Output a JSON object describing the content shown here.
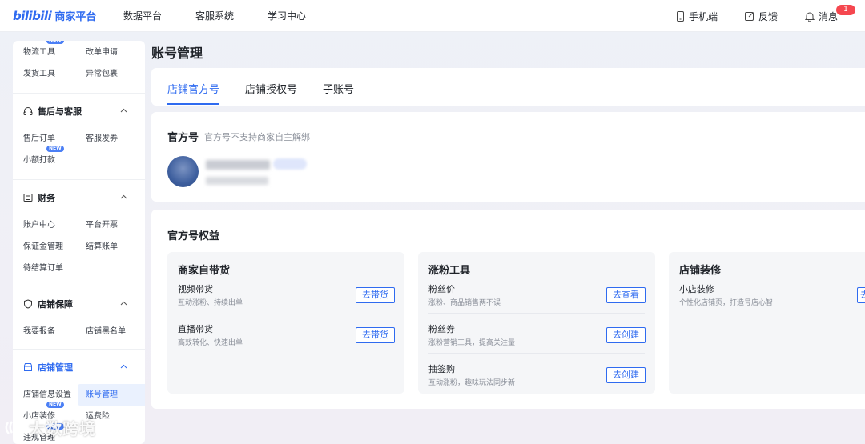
{
  "topbar": {
    "logo_mark": "bilibili",
    "logo_text": "商家平台",
    "nav": [
      "数据平台",
      "客服系统",
      "学习中心"
    ],
    "mobile": "手机端",
    "feedback": "反馈",
    "messages": "消息",
    "message_count": "1"
  },
  "sidebar": {
    "new_tag": "NEW",
    "top_links": [
      "物流工具",
      "改单申请",
      "发货工具",
      "异常包裹"
    ],
    "after_sales": {
      "title": "售后与客服",
      "links": [
        "售后订单",
        "客服发券",
        "小额打款"
      ]
    },
    "finance": {
      "title": "财务",
      "links": [
        "账户中心",
        "平台开票",
        "保证金管理",
        "结算账单",
        "待结算订单"
      ]
    },
    "guarantee": {
      "title": "店铺保障",
      "links": [
        "我要报备",
        "店铺黑名单"
      ]
    },
    "shop_mgmt": {
      "title": "店铺管理",
      "links": [
        "店铺信息设置",
        "账号管理",
        "小店装修",
        "运费险",
        "违规管理"
      ]
    }
  },
  "main": {
    "page_title": "账号管理",
    "tabs": [
      "店铺官方号",
      "店铺授权号",
      "子账号"
    ],
    "official": {
      "title": "官方号",
      "note": "官方号不支持商家自主解绑"
    },
    "rights": {
      "title": "官方号权益",
      "panels": [
        {
          "title": "商家自带货",
          "rows": [
            {
              "name": "视频带货",
              "desc": "互动涨粉、持续出单",
              "btn": "去带货"
            },
            {
              "name": "直播带货",
              "desc": "高效转化、快速出单",
              "btn": "去带货"
            }
          ]
        },
        {
          "title": "涨粉工具",
          "rows": [
            {
              "name": "粉丝价",
              "desc": "涨粉、商品销售两不误",
              "btn": "去查看"
            },
            {
              "name": "粉丝券",
              "desc": "涨粉营销工具，提高关注量",
              "btn": "去创建"
            },
            {
              "name": "抽签购",
              "desc": "互动涨粉，趣味玩法同步新",
              "btn": "去创建"
            }
          ]
        },
        {
          "title": "店铺装修",
          "rows": [
            {
              "name": "小店装修",
              "desc": "个性化店铺页，打造号店心智",
              "btn": "去"
            }
          ]
        }
      ]
    }
  },
  "watermark": "大数跨境",
  "colors": {
    "accent": "#2f6bf0",
    "badge": "#f5474f"
  }
}
